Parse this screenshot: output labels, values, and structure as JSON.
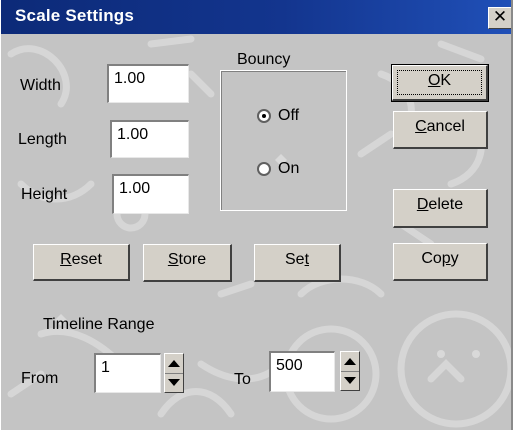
{
  "window": {
    "title": "Scale Settings",
    "close_glyph": "✕"
  },
  "fields": {
    "width": {
      "label": "Width",
      "value": "1.00"
    },
    "length": {
      "label": "Length",
      "value": "1.00"
    },
    "height": {
      "label": "Height",
      "value": "1.00"
    }
  },
  "bouncy": {
    "label": "Bouncy",
    "options": [
      {
        "label": "Off",
        "selected": true
      },
      {
        "label": "On",
        "selected": false
      }
    ]
  },
  "buttons": {
    "ok": {
      "mnemonic": "O",
      "rest": "K"
    },
    "cancel": {
      "mnemonic": "C",
      "rest": "ancel"
    },
    "delete": {
      "mnemonic": "D",
      "rest": "elete"
    },
    "copy": {
      "pre": "Co",
      "mnemonic": "p",
      "rest": "y"
    },
    "reset": {
      "mnemonic": "R",
      "rest": "eset"
    },
    "store": {
      "mnemonic": "S",
      "rest": "tore"
    },
    "set": {
      "pre": "Se",
      "mnemonic": "t",
      "rest": ""
    }
  },
  "timeline": {
    "label": "Timeline Range",
    "from": {
      "label": "From",
      "value": "1"
    },
    "to": {
      "label": "To",
      "value": "500"
    }
  },
  "icons": [
    "close-icon",
    "spin-up-icon",
    "spin-down-icon"
  ]
}
